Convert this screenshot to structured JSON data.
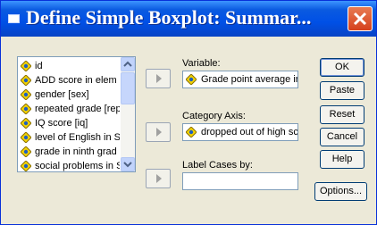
{
  "window": {
    "title": "Define Simple Boxplot: Summar..."
  },
  "variable_list": {
    "items": [
      {
        "label": "id"
      },
      {
        "label": "ADD score in elem"
      },
      {
        "label": "gender [sex]"
      },
      {
        "label": "repeated grade [rep"
      },
      {
        "label": "IQ score [iq]"
      },
      {
        "label": "level of English in S"
      },
      {
        "label": "grade in ninth grad"
      },
      {
        "label": "social problems in S"
      }
    ]
  },
  "fields": {
    "variable": {
      "label": "Variable:",
      "value": "Grade point average ir"
    },
    "category_axis": {
      "label": "Category Axis:",
      "value": "dropped out of high sc"
    },
    "label_cases": {
      "label": "Label Cases by:",
      "value": ""
    }
  },
  "buttons": {
    "ok": "OK",
    "paste": "Paste",
    "reset": "Reset",
    "cancel": "Cancel",
    "help": "Help",
    "options": "Options..."
  },
  "colors": {
    "titlebar": "#0a5ae0",
    "close": "#d5401d",
    "dialog_bg": "#ece9d8",
    "icon_yellow": "#f5d400"
  }
}
